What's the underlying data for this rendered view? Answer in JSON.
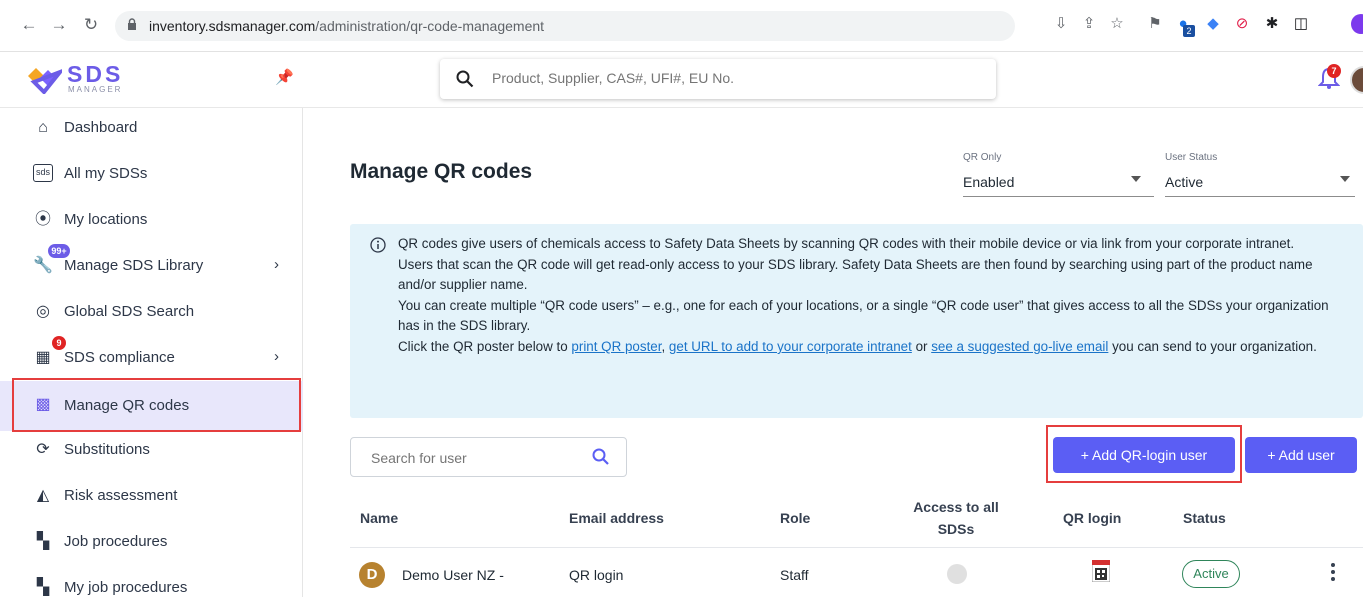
{
  "browser": {
    "url_domain": "inventory.sdsmanager.com",
    "url_path": "/administration/qr-code-management",
    "extension_badge": "2"
  },
  "header": {
    "logo_text": "SDS",
    "logo_sub": "MANAGER",
    "search_placeholder": "Product, Supplier, CAS#, UFI#, EU No.",
    "notification_count": "7"
  },
  "sidebar": {
    "items": [
      {
        "label": "Dashboard",
        "icon": "home-icon"
      },
      {
        "label": "All my SDSs",
        "icon": "sds-icon"
      },
      {
        "label": "My locations",
        "icon": "location-icon"
      },
      {
        "label": "Manage SDS Library",
        "icon": "wrench-icon",
        "badge": "99+"
      },
      {
        "label": "Global SDS Search",
        "icon": "global-search-icon"
      },
      {
        "label": "SDS compliance",
        "icon": "building-icon",
        "badge": "9"
      },
      {
        "label": "Manage QR codes",
        "icon": "qr-icon"
      },
      {
        "label": "Substitutions",
        "icon": "substitution-icon"
      },
      {
        "label": "Risk assessment",
        "icon": "risk-icon"
      },
      {
        "label": "Job procedures",
        "icon": "job-procedure-icon"
      },
      {
        "label": "My job procedures",
        "icon": "my-job-procedure-icon"
      }
    ]
  },
  "main": {
    "title": "Manage QR codes",
    "filters": {
      "qr_only_label": "QR Only",
      "qr_only_value": "Enabled",
      "user_status_label": "User Status",
      "user_status_value": "Active"
    },
    "info": {
      "line1": "QR codes give users of chemicals access to Safety Data Sheets by scanning QR codes with their mobile device or via link from your corporate intranet.",
      "line2": "Users that scan the QR code will get read-only access to your SDS library. Safety Data Sheets are then found by searching using part of the product name and/or supplier name.",
      "line3": "You can create multiple “QR code users” – e.g., one for each of your locations, or a single “QR code user” that gives access to all the SDSs your organization has in the SDS library.",
      "line4_prefix": "Click the QR poster below to ",
      "link_print": "print QR poster",
      "sep1": ", ",
      "link_url": "get URL to add to your corporate intranet",
      "sep2": " or ",
      "link_email": "see a suggested go-live email",
      "line4_suffix": " you can send to your organization."
    },
    "user_search_placeholder": "Search for user",
    "add_qr_login_user": "+  Add QR-login user",
    "add_user": "+  Add user",
    "table": {
      "headers": [
        "Name",
        "Email address",
        "Role",
        "Access to all SDSs",
        "QR login",
        "Status"
      ],
      "rows": [
        {
          "avatar": "D",
          "name": "Demo User NZ -",
          "email": "QR login",
          "role": "Staff",
          "status": "Active"
        }
      ]
    }
  }
}
